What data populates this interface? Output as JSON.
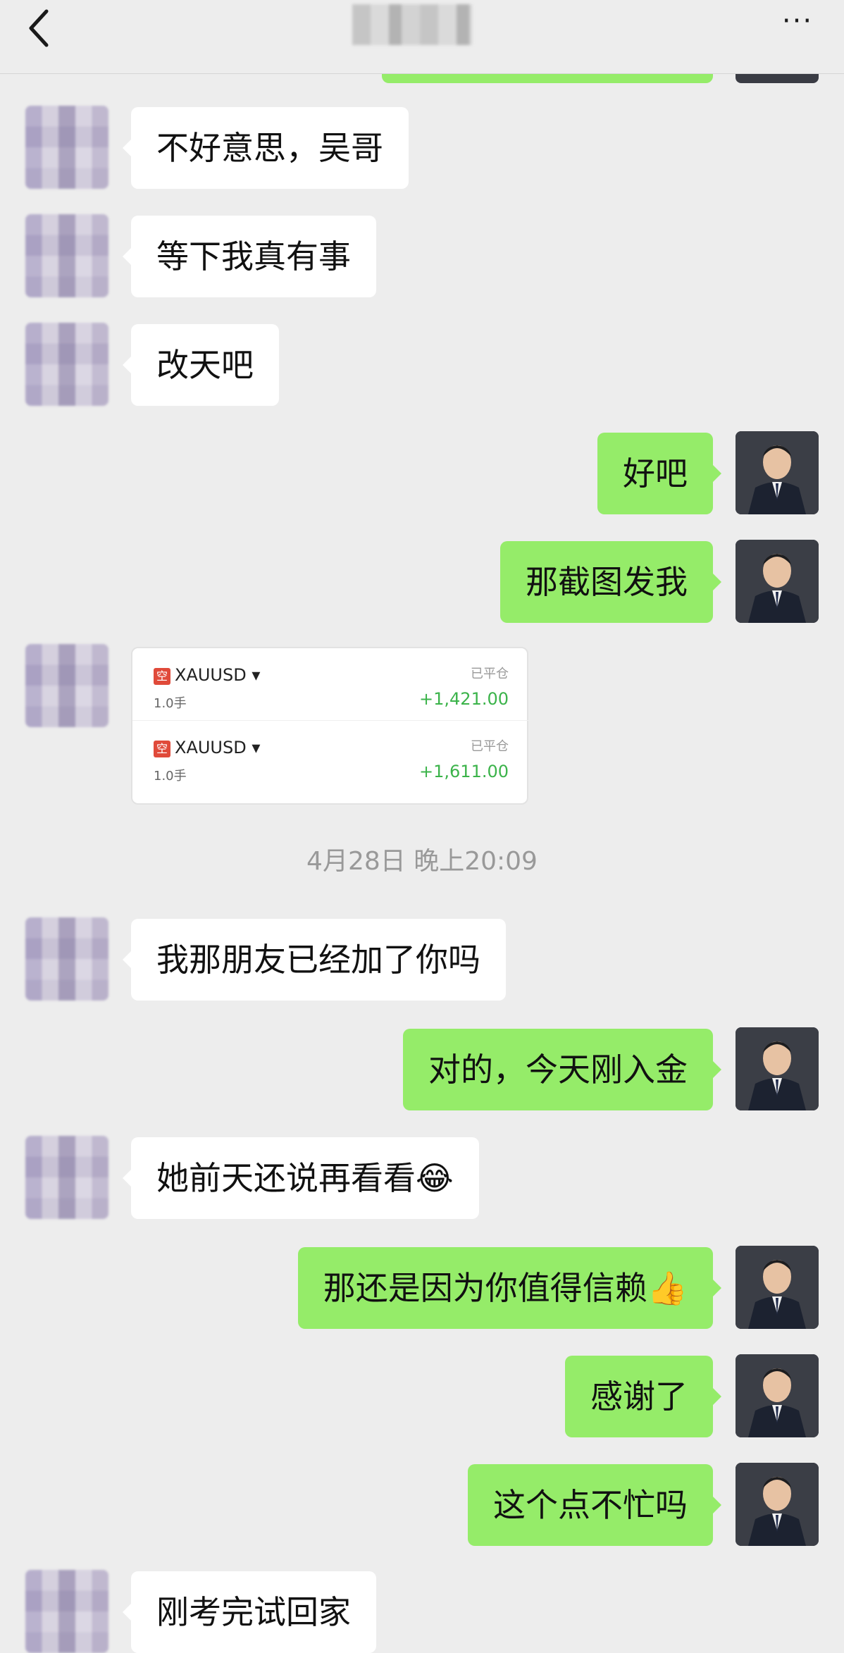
{
  "header": {
    "back_icon": "chevron-left-icon",
    "more_icon": "ellipsis-icon",
    "more_label": "···"
  },
  "messages": [
    {
      "from": "other",
      "text": "不好意思，吴哥"
    },
    {
      "from": "other",
      "text": "等下我真有事"
    },
    {
      "from": "other",
      "text": "改天吧"
    },
    {
      "from": "self",
      "text": "好吧"
    },
    {
      "from": "self",
      "text": "那截图发我"
    },
    {
      "from": "self",
      "text": "对的，今天刚入金"
    },
    {
      "from": "other",
      "text": "我那朋友已经加了你吗"
    },
    {
      "from": "other",
      "text": "她前天还说再看看😂"
    },
    {
      "from": "self",
      "text": "那还是因为你值得信赖👍"
    },
    {
      "from": "self",
      "text": "感谢了"
    },
    {
      "from": "self",
      "text": "这个点不忙吗"
    },
    {
      "from": "other",
      "text": "刚考完试回家"
    }
  ],
  "timestamp": "4月28日 晚上20:09",
  "trades": [
    {
      "badge": "空",
      "symbol": "XAUUSD ▾",
      "status": "已平仓",
      "lots": "1.0手",
      "pnl": "+1,421.00"
    },
    {
      "badge": "空",
      "symbol": "XAUUSD ▾",
      "status": "已平仓",
      "lots": "1.0手",
      "pnl": "+1,611.00"
    }
  ],
  "colors": {
    "background": "#ededed",
    "incoming_bubble": "#ffffff",
    "outgoing_bubble": "#95ec69",
    "profit_green": "#3bb34a",
    "badge_red": "#e04a3a"
  }
}
